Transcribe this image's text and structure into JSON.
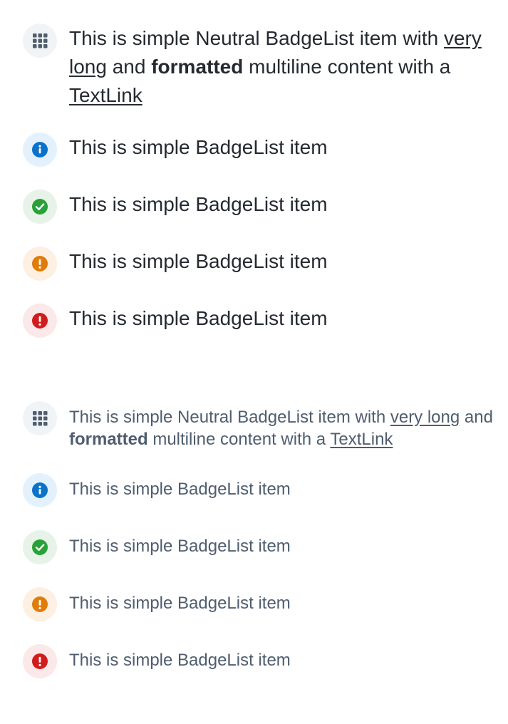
{
  "colors": {
    "neutral_bg": "#f1f4f7",
    "neutral_fg": "#4f5d6e",
    "info_bg": "#e3f1fc",
    "info_fg": "#0a72c9",
    "success_bg": "#e7f3e8",
    "success_fg": "#28a138",
    "warning_bg": "#fdf0e3",
    "warning_fg": "#e07c0a",
    "critical_bg": "#fbe8e8",
    "critical_fg": "#d21c1c"
  },
  "large": {
    "neutral": {
      "icon": "grid-icon",
      "t1": "This is simple Neutral BadgeList item with ",
      "link1": "very long",
      "t2": " and ",
      "bold": "formatted",
      "t3": " multiline content with a ",
      "link2": "TextLink"
    },
    "items": [
      {
        "type": "info",
        "icon": "info-icon",
        "label": "This is simple BadgeList item"
      },
      {
        "type": "success",
        "icon": "check-icon",
        "label": "This is simple BadgeList item"
      },
      {
        "type": "warning",
        "icon": "alert-icon",
        "label": "This is simple BadgeList item"
      },
      {
        "type": "critical",
        "icon": "alert-icon",
        "label": "This is simple BadgeList item"
      }
    ]
  },
  "small": {
    "neutral": {
      "icon": "grid-icon",
      "t1": "This is simple Neutral BadgeList item with ",
      "link1": "very long",
      "t2": " and ",
      "bold": "formatted",
      "t3": " multiline content with a ",
      "link2": "TextLink"
    },
    "items": [
      {
        "type": "info",
        "icon": "info-icon",
        "label": "This is simple BadgeList item"
      },
      {
        "type": "success",
        "icon": "check-icon",
        "label": "This is simple BadgeList item"
      },
      {
        "type": "warning",
        "icon": "alert-icon",
        "label": "This is simple BadgeList item"
      },
      {
        "type": "critical",
        "icon": "alert-icon",
        "label": "This is simple BadgeList item"
      }
    ]
  }
}
